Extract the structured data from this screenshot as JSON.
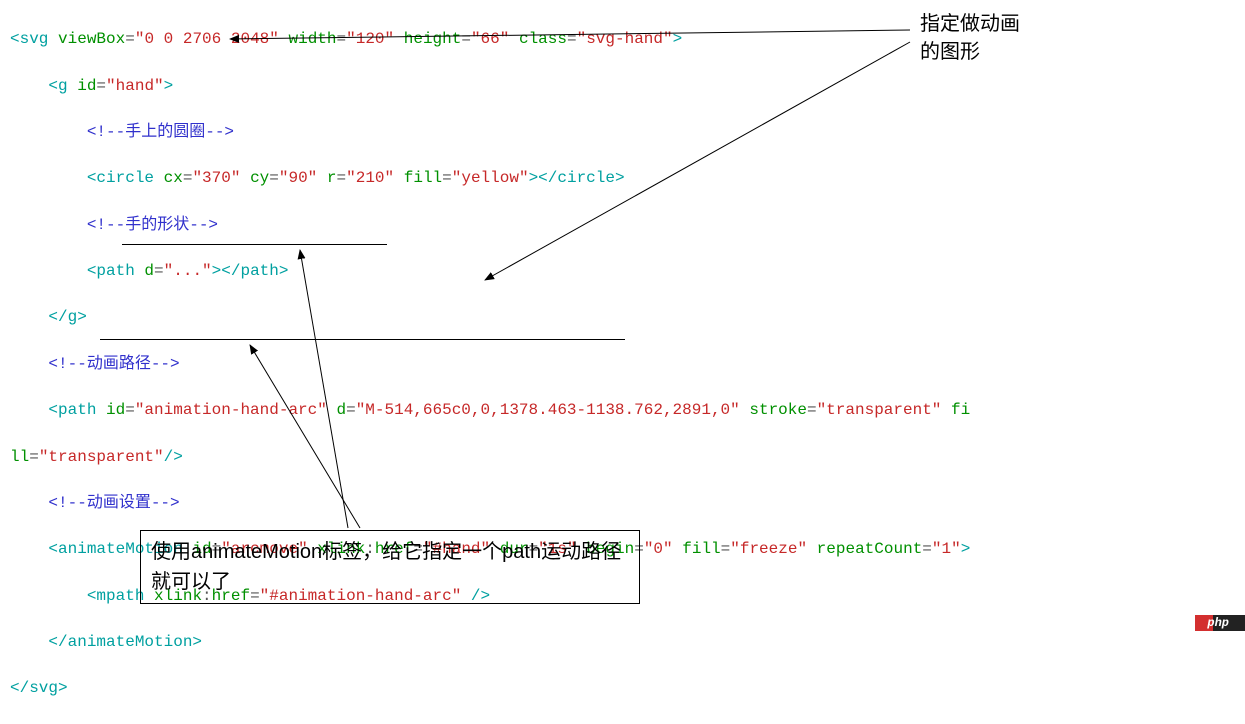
{
  "anno": {
    "right1": "指定做动画",
    "right2": "的图形",
    "box": "使用animateMotion标签，给它指定一个path运动路径就可以了"
  },
  "wm": "php",
  "code": {
    "l01": {
      "a": "<svg ",
      "b": "viewBox",
      "c": "=",
      "d": "\"0 0 2706 2048\"",
      "e": " ",
      "f": "width",
      "g": "=",
      "h": "\"120\"",
      "i": " ",
      "j": "height",
      "k": "=",
      "l": "\"66\"",
      "m": " ",
      "n": "class",
      "o": "=",
      "p": "\"svg-hand\"",
      "q": ">"
    },
    "l02": {
      "a": "    <g ",
      "b": "id",
      "c": "=",
      "d": "\"hand\"",
      "e": ">"
    },
    "l03": {
      "a": "        <!--手上的圆圈-->"
    },
    "l04": {
      "a": "        <circle ",
      "b": "cx",
      "c": "=",
      "d": "\"370\"",
      "e": " ",
      "f": "cy",
      "g": "=",
      "h": "\"90\"",
      "i": " ",
      "j": "r",
      "k": "=",
      "l": "\"210\"",
      "m": " ",
      "n": "fill",
      "o": "=",
      "p": "\"yellow\"",
      "q": "></circle>"
    },
    "l05": {
      "a": "        <!--手的形状-->"
    },
    "l06": {
      "a": "        <path ",
      "b": "d",
      "c": "=",
      "d": "\"...\"",
      "e": "></path>"
    },
    "l07": {
      "a": "    </g>"
    },
    "l08": {
      "a": "    <!--动画路径-->"
    },
    "l09": {
      "a": "    <path ",
      "b": "id",
      "c": "=",
      "d": "\"animation-hand-arc\"",
      "e": " ",
      "f": "d",
      "g": "=",
      "h": "\"M-514,665c0,0,1378.463-1138.762,2891,0\"",
      "i": " ",
      "j": "stroke",
      "k": "=",
      "l": "\"transparent\"",
      "m": " fi"
    },
    "l10": {
      "a": "ll",
      "b": "=",
      "c": "\"transparent\"",
      "d": "/>"
    },
    "l11": {
      "a": "    <!--动画设置-->"
    },
    "l12": {
      "a": "    <animateMotion ",
      "b": "id",
      "c": "=",
      "d": "\"arcmove\"",
      "e": " ",
      "f": "xlink",
      "g": ":",
      "h": "href",
      "i": "=",
      "j": "\"#hand\"",
      "k": " ",
      "l": "dur",
      "m": "=",
      "n": "\"1s\"",
      "o": " ",
      "p": "begin",
      "q": "=",
      "r": "\"0\"",
      "s": " ",
      "t": "fill",
      "u": "=",
      "v": "\"freeze\"",
      "w": " ",
      "x": "repeatCount",
      "y": "=",
      "z": "\"1\"",
      "aa": ">"
    },
    "l13": {
      "a": "        <mpath ",
      "b": "xlink",
      "c": ":",
      "d": "href",
      "e": "=",
      "f": "\"#animation-hand-arc\"",
      "g": " />"
    },
    "l14": {
      "a": "    </animateMotion>"
    },
    "l15": {
      "a": "</svg>"
    }
  }
}
